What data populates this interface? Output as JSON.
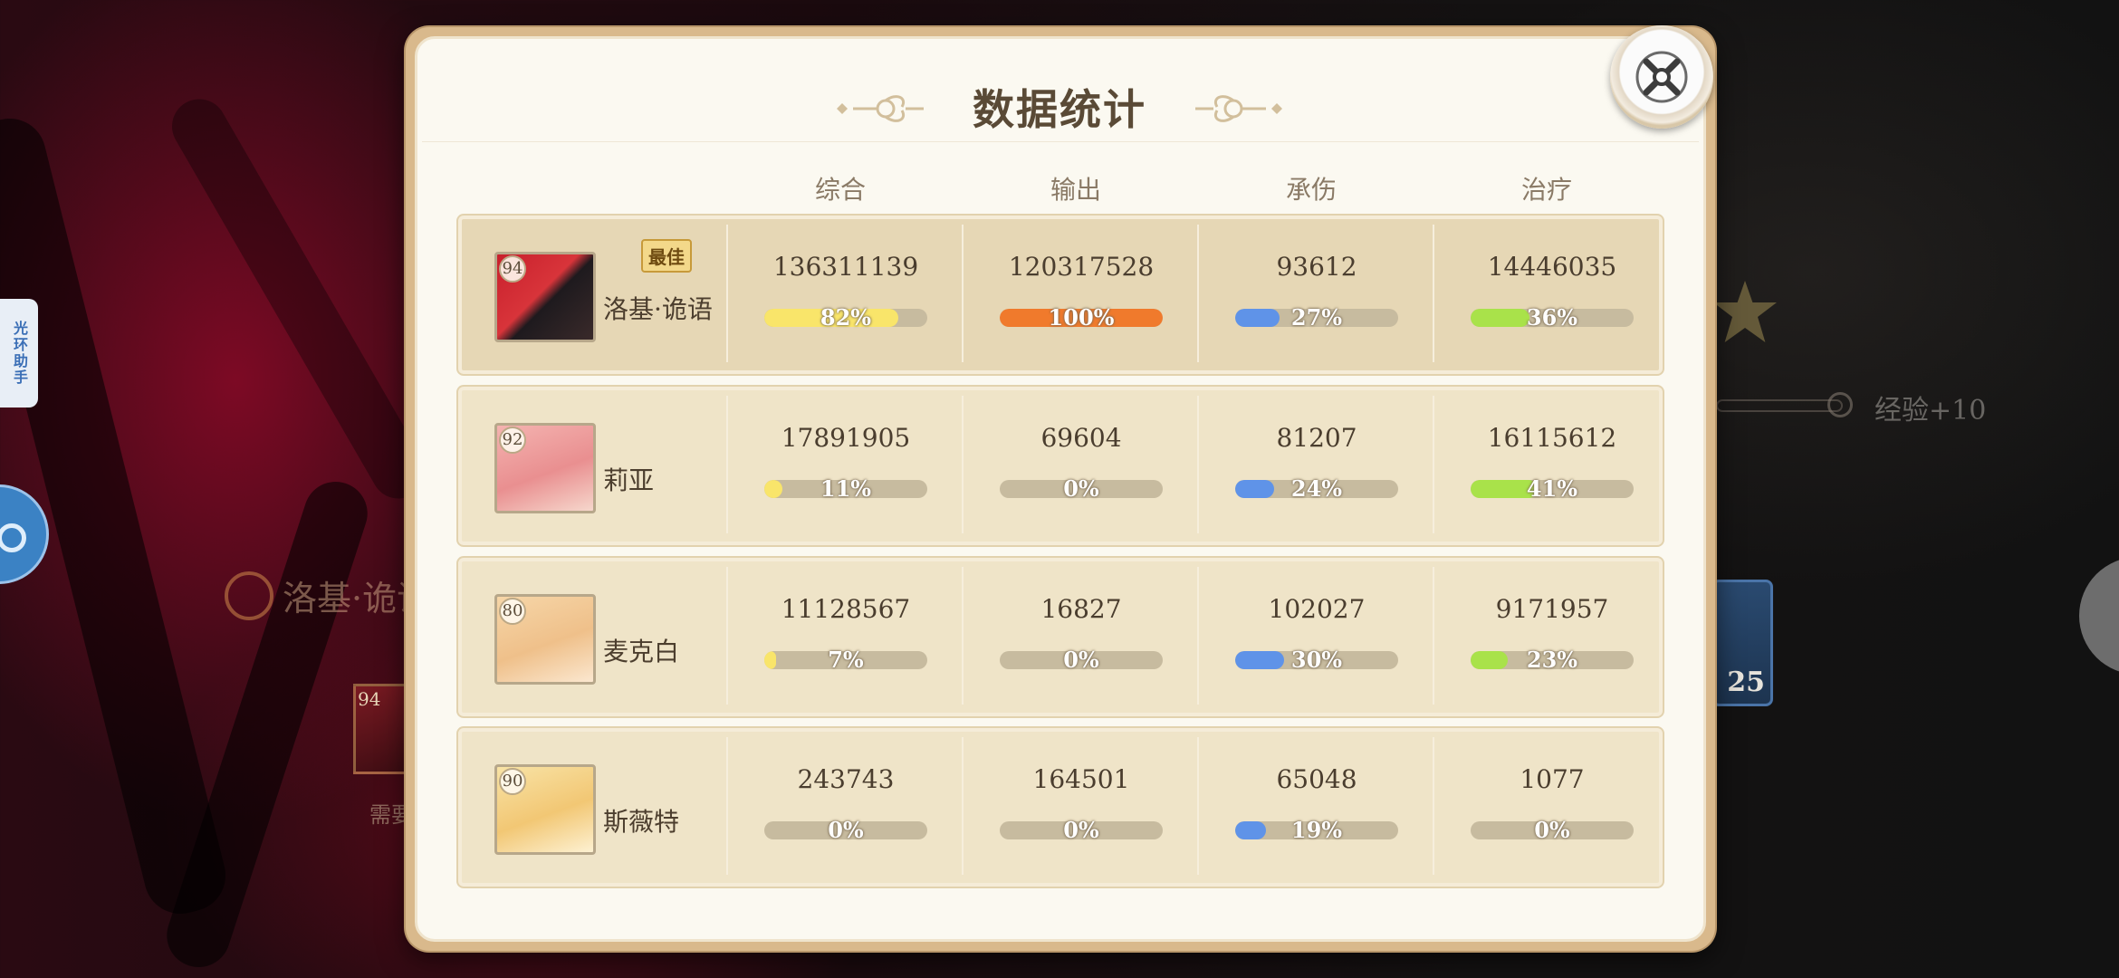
{
  "modal": {
    "title": "数据统计",
    "columns": [
      "综合",
      "输出",
      "承伤",
      "治疗"
    ],
    "best_badge": "最佳",
    "rows": [
      {
        "level": "94",
        "name": "洛基·诡语",
        "best": true,
        "stats": [
          {
            "value": "136311139",
            "percent": "82%",
            "fraction": 0.82,
            "color": "#f9e56a"
          },
          {
            "value": "120317528",
            "percent": "100%",
            "fraction": 1.0,
            "color": "#f07a2c"
          },
          {
            "value": "93612",
            "percent": "27%",
            "fraction": 0.27,
            "color": "#5f93e8"
          },
          {
            "value": "14446035",
            "percent": "36%",
            "fraction": 0.36,
            "color": "#a9e24a"
          }
        ]
      },
      {
        "level": "92",
        "name": "莉亚",
        "best": false,
        "stats": [
          {
            "value": "17891905",
            "percent": "11%",
            "fraction": 0.11,
            "color": "#f9e56a"
          },
          {
            "value": "69604",
            "percent": "0%",
            "fraction": 0.0,
            "color": "#f07a2c"
          },
          {
            "value": "81207",
            "percent": "24%",
            "fraction": 0.24,
            "color": "#5f93e8"
          },
          {
            "value": "16115612",
            "percent": "41%",
            "fraction": 0.41,
            "color": "#a9e24a"
          }
        ]
      },
      {
        "level": "80",
        "name": "麦克白",
        "best": false,
        "stats": [
          {
            "value": "11128567",
            "percent": "7%",
            "fraction": 0.07,
            "color": "#f9e56a"
          },
          {
            "value": "16827",
            "percent": "0%",
            "fraction": 0.0,
            "color": "#f07a2c"
          },
          {
            "value": "102027",
            "percent": "30%",
            "fraction": 0.3,
            "color": "#5f93e8"
          },
          {
            "value": "9171957",
            "percent": "23%",
            "fraction": 0.23,
            "color": "#a9e24a"
          }
        ]
      },
      {
        "level": "90",
        "name": "斯薇特",
        "best": false,
        "stats": [
          {
            "value": "243743",
            "percent": "0%",
            "fraction": 0.0,
            "color": "#f9e56a"
          },
          {
            "value": "164501",
            "percent": "0%",
            "fraction": 0.0,
            "color": "#f07a2c"
          },
          {
            "value": "65048",
            "percent": "19%",
            "fraction": 0.19,
            "color": "#5f93e8"
          },
          {
            "value": "1077",
            "percent": "0%",
            "fraction": 0.0,
            "color": "#a9e24a"
          }
        ]
      }
    ]
  },
  "background": {
    "helper_tab": "光环助手",
    "char_name": "洛基·诡语",
    "portrait_level": "94",
    "need_text": "需要",
    "exp_text": "经验+10",
    "item_count": "25"
  },
  "icons": {
    "close": "close-x-icon",
    "ornament": "flourish-ornament-icon",
    "float_ball": "floating-assistant-icon"
  }
}
